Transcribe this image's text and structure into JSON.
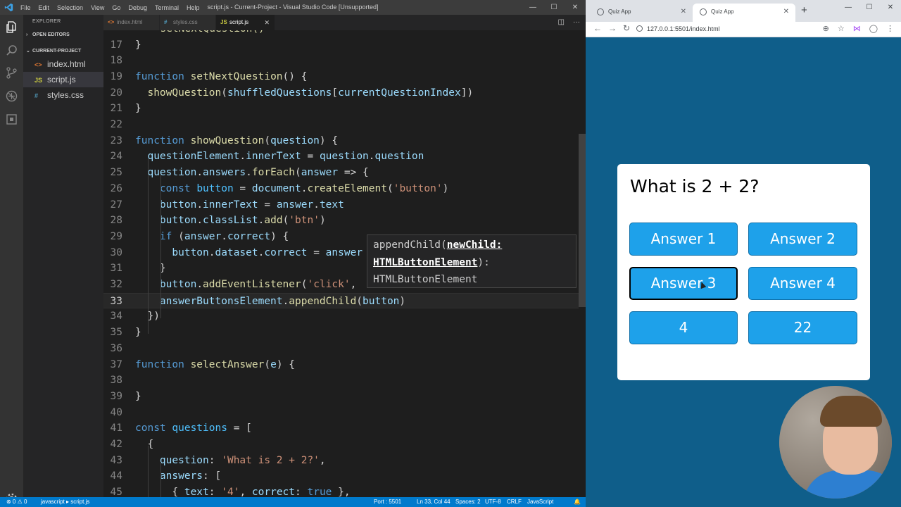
{
  "vscode": {
    "menu": [
      "File",
      "Edit",
      "Selection",
      "View",
      "Go",
      "Debug",
      "Terminal",
      "Help"
    ],
    "window_title": "script.js - Current-Project - Visual Studio Code [Unsupported]",
    "window_controls": [
      "—",
      "☐",
      "✕"
    ],
    "sidebar": {
      "title": "EXPLORER",
      "open_editors": "OPEN EDITORS",
      "project": "CURRENT-PROJECT",
      "files": [
        {
          "icon": "<>",
          "name": "index.html",
          "icon_color": "#e37933"
        },
        {
          "icon": "JS",
          "name": "script.js",
          "icon_color": "#cbcb41",
          "selected": true
        },
        {
          "icon": "#",
          "name": "styles.css",
          "icon_color": "#519aba"
        }
      ]
    },
    "tabs": [
      {
        "icon": "<>",
        "label": "index.html",
        "icon_color": "#e37933"
      },
      {
        "icon": "#",
        "label": "styles.css",
        "icon_color": "#519aba"
      },
      {
        "icon": "JS",
        "label": "script.js",
        "icon_color": "#cbcb41",
        "active": true,
        "close": "✕"
      }
    ],
    "tab_actions": [
      "split-editor-icon",
      "more-actions-icon"
    ],
    "code": {
      "partial_top": "  setNextQuestion()",
      "lines": [
        {
          "n": "17",
          "text": "}"
        },
        {
          "n": "18",
          "text": ""
        },
        {
          "n": "19",
          "text": "function setNextQuestion() {"
        },
        {
          "n": "20",
          "text": "  showQuestion(shuffledQuestions[currentQuestionIndex])"
        },
        {
          "n": "21",
          "text": "}"
        },
        {
          "n": "22",
          "text": ""
        },
        {
          "n": "23",
          "text": "function showQuestion(question) {"
        },
        {
          "n": "24",
          "text": "  questionElement.innerText = question.question"
        },
        {
          "n": "25",
          "text": "  question.answers.forEach(answer => {"
        },
        {
          "n": "26",
          "text": "    const button = document.createElement('button')"
        },
        {
          "n": "27",
          "text": "    button.innerText = answer.text"
        },
        {
          "n": "28",
          "text": "    button.classList.add('btn')"
        },
        {
          "n": "29",
          "text": "    if (answer.correct) {"
        },
        {
          "n": "30",
          "text": "      button.dataset.correct = answer"
        },
        {
          "n": "31",
          "text": "    }"
        },
        {
          "n": "32",
          "text": "    button.addEventListener('click',"
        },
        {
          "n": "33",
          "text": "    answerButtonsElement.appendChild(button)"
        },
        {
          "n": "34",
          "text": "  })"
        },
        {
          "n": "35",
          "text": "}"
        },
        {
          "n": "36",
          "text": ""
        },
        {
          "n": "37",
          "text": "function selectAnswer(e) {"
        },
        {
          "n": "38",
          "text": ""
        },
        {
          "n": "39",
          "text": "}"
        },
        {
          "n": "40",
          "text": ""
        },
        {
          "n": "41",
          "text": "const questions = ["
        },
        {
          "n": "42",
          "text": "  {"
        },
        {
          "n": "43",
          "text": "    question: 'What is 2 + 2?',"
        },
        {
          "n": "44",
          "text": "    answers: ["
        },
        {
          "n": "45",
          "text": "      { text: '4', correct: true },"
        }
      ]
    },
    "hover": {
      "line1_prefix": "appendChild(",
      "line1_param": "newChild:",
      "line2_type": "HTMLButtonElement",
      "line2_suffix": "):",
      "line3": "HTMLButtonElement"
    },
    "statusbar": {
      "errors": "⊗ 0  ⚠ 0",
      "breadcrumb": "javascript  ▸ script.js",
      "port": "Port : 5501",
      "position": "Ln 33, Col 44",
      "spaces": "Spaces: 2",
      "encoding": "UTF-8",
      "eol": "CRLF",
      "language": "JavaScript",
      "bell": "🔔"
    }
  },
  "browser": {
    "tabs": [
      {
        "label": "Quiz App",
        "close": "✕"
      },
      {
        "label": "Quiz App",
        "close": "✕",
        "active": true
      }
    ],
    "new_tab": "+",
    "window_controls": [
      "—",
      "☐",
      "✕"
    ],
    "url": "127.0.0.1:5501/index.html",
    "page_bg": "#0f5e8a",
    "quiz": {
      "question": "What is 2 + 2?",
      "answers": [
        "Answer 1",
        "Answer 2",
        "Answer 3",
        "Answer 4",
        "4",
        "22"
      ],
      "button_color": "#1ea1ea"
    }
  }
}
